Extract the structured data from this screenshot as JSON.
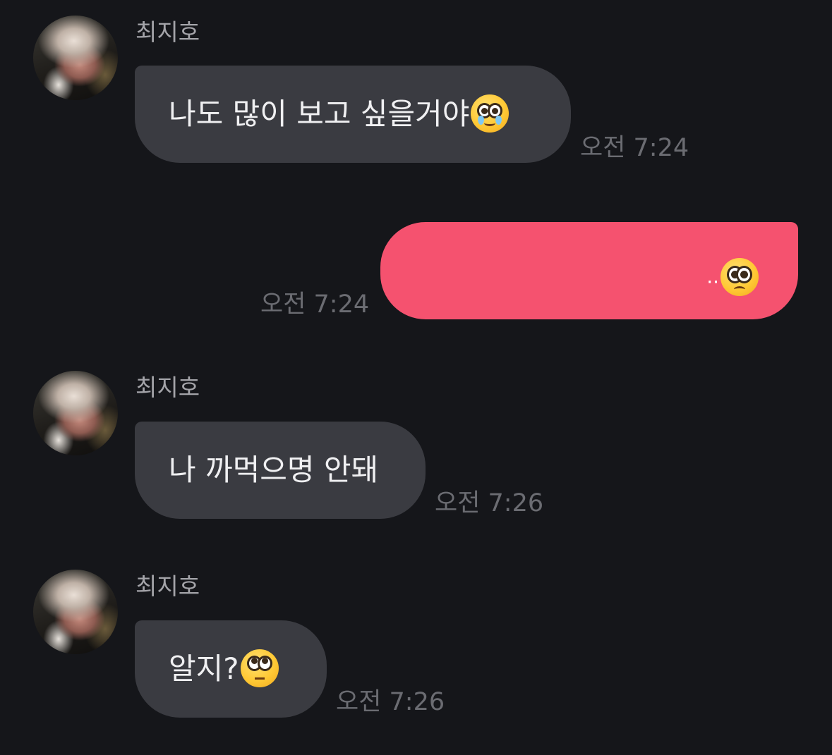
{
  "messages": [
    {
      "sender": "최지호",
      "text": "나도 많이 보고 싶을거야",
      "emoji": "face-holding-back-tears-icon",
      "time": "오전 7:24",
      "direction": "incoming"
    },
    {
      "text": "..",
      "emoji": "pleading-face-icon",
      "time": "오전 7:24",
      "direction": "outgoing"
    },
    {
      "sender": "최지호",
      "text": "나 까먹으명 안돼",
      "time": "오전 7:26",
      "direction": "incoming"
    },
    {
      "sender": "최지호",
      "text": "알지?",
      "emoji": "face-with-rolling-eyes-icon",
      "time": "오전 7:26",
      "direction": "incoming"
    }
  ],
  "colors": {
    "background": "#15161a",
    "incoming_bubble": "#3a3b41",
    "outgoing_bubble": "#f5526f",
    "sender_name": "#a4a4a9",
    "timestamp": "#6b6c72"
  }
}
